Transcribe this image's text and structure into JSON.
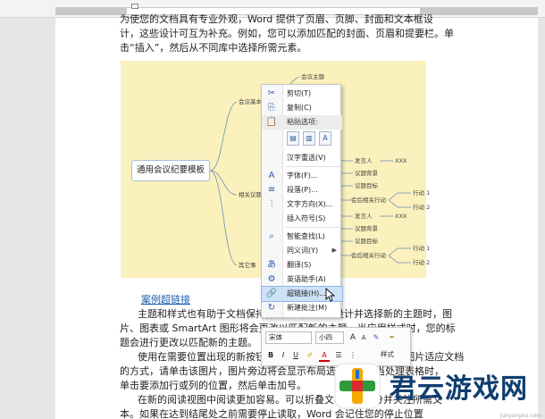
{
  "document": {
    "lines": [
      "为使您的文档具有专业外观，Word 提供了页眉、页脚、封面和文本框设",
      "计，这些设计可互为补充。例如，您可以添加匹配的封面、页眉和提要栏。单",
      "击“插入”，然后从不同库中选择所需元素。"
    ],
    "link_text": "案例超链接",
    "para2": [
      "主题和样式也有助于文档保持协调。当您单击设计并选择新的主题时，图",
      "片、图表或 SmartArt 图形将会更改以匹配新的主题。当应用样式时，您的标",
      "题会进行更改以匹配新的主题。"
    ],
    "para3": [
      "使用在需要位置出现的新按钮在 Word 中保存时间。若要更改图片适应文档",
      "的方式，请单击该图片，图片旁边将会显示布局选项按钮。当处理表格时，",
      "单击要添加行或列的位置，然后单击加号。"
    ],
    "para4": [
      "在新的阅读视图中阅读更加容易。可以折叠文档某些部分并关注所需文",
      "本。如果在达到结尾处之前需要停止读取，Word 会记住您的停止位置"
    ]
  },
  "mindmap": {
    "root": "通用会议纪要模板",
    "branches": [
      "会议基本",
      "相关议题",
      "其它事"
    ],
    "top_leaf": "会议主题",
    "right_nodes": [
      {
        "label": "发言人",
        "extra": "XXX"
      },
      {
        "label": "议题背景",
        "extra": ""
      },
      {
        "label": "议题目标",
        "extra": ""
      },
      {
        "label": "会后相关行动",
        "extra": ""
      },
      {
        "label": "发言人",
        "extra": "XXX"
      },
      {
        "label": "议题背景",
        "extra": ""
      },
      {
        "label": "议题目标",
        "extra": ""
      },
      {
        "label": "会后相关行动",
        "extra": ""
      }
    ],
    "actions": [
      "行动 1",
      "行动 2",
      "行动 1",
      "行动 2"
    ]
  },
  "context_menu": {
    "items": [
      {
        "icon": "✂",
        "label": "剪切(T)"
      },
      {
        "icon": "⎘",
        "label": "复制(C)"
      },
      {
        "icon": "📋",
        "label": "粘贴选项:"
      },
      {
        "icon": "",
        "label": "汉字重选(V)"
      },
      {
        "icon": "A",
        "label": "字体(F)..."
      },
      {
        "icon": "≡",
        "label": "段落(P)..."
      },
      {
        "icon": "⫶",
        "label": "文字方向(X)..."
      },
      {
        "icon": "",
        "label": "插入符号(S)"
      },
      {
        "icon": "⌕",
        "label": "智能查找(L)"
      },
      {
        "icon": "",
        "label": "同义词(Y)"
      },
      {
        "icon": "あ",
        "label": "翻译(S)"
      },
      {
        "icon": "⚙",
        "label": "英语助手(A)"
      },
      {
        "icon": "🔗",
        "label": "超链接(H)..."
      },
      {
        "icon": "↻",
        "label": "新建批注(M)"
      }
    ]
  },
  "mini_toolbar": {
    "font": "宋体",
    "size": "小四",
    "style_label": "样式",
    "bold": "B",
    "italic": "I",
    "underline": "U",
    "grow": "A",
    "shrink": "A"
  },
  "watermark": {
    "text": "君云游戏网",
    "url": "junyunyou.com"
  },
  "colors": {
    "mindmap_bg": "#faf1bd",
    "highlight": "#cde1f7",
    "link": "#1e5fb3",
    "watermark": "#0f3e6e"
  }
}
